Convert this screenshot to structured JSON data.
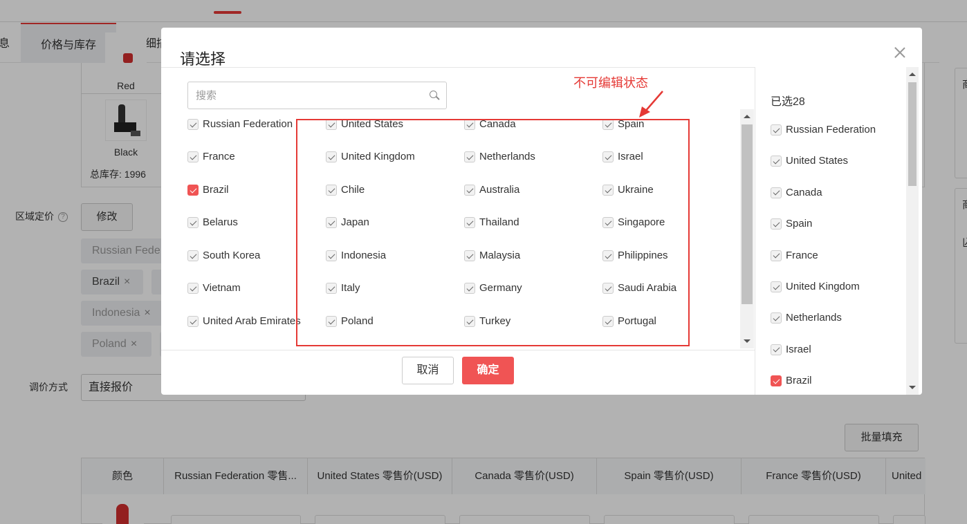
{
  "background": {
    "tabs": [
      {
        "label": "息"
      },
      {
        "label": "价格与库存"
      },
      {
        "label": "详细描"
      }
    ],
    "products": [
      {
        "name": "Red"
      },
      {
        "name": "Black"
      }
    ],
    "total_stock_label": "总库存:",
    "total_stock_value": "1996",
    "regional_pricing_label": "区域定价",
    "help_icon": "?",
    "modify_button": "修改",
    "chips": [
      {
        "text": "Russian Fede"
      },
      {
        "text": "Brazil"
      },
      {
        "text": "Indonesia"
      },
      {
        "text": "Poland"
      }
    ],
    "chip_close_glyph": "×",
    "pricing_method_label": "调价方式",
    "pricing_method_value": "直接报价",
    "batch_fill_button": "批量填充",
    "table_headers": [
      "颜色",
      "Russian Federation 零售...",
      "United States 零售价(USD)",
      "Canada 零售价(USD)",
      "Spain 零售价(USD)",
      "France 零售价(USD)",
      "United"
    ],
    "right_panel_glyphs": [
      "商",
      "商",
      "兦"
    ]
  },
  "modal": {
    "title": "请选择",
    "close_icon": "close-icon",
    "search_placeholder": "搜索",
    "search_icon": "search-icon",
    "columns": [
      [
        {
          "label": "Russian Federation",
          "checked": true,
          "editable": false
        },
        {
          "label": "France",
          "checked": true,
          "editable": false
        },
        {
          "label": "Brazil",
          "checked": true,
          "editable": true
        },
        {
          "label": "Belarus",
          "checked": true,
          "editable": false
        },
        {
          "label": "South Korea",
          "checked": true,
          "editable": false
        },
        {
          "label": "Vietnam",
          "checked": true,
          "editable": false
        },
        {
          "label": "United Arab Emirates",
          "checked": true,
          "editable": false
        }
      ],
      [
        {
          "label": "United States",
          "checked": true,
          "editable": false
        },
        {
          "label": "United Kingdom",
          "checked": true,
          "editable": false
        },
        {
          "label": "Chile",
          "checked": true,
          "editable": false
        },
        {
          "label": "Japan",
          "checked": true,
          "editable": false
        },
        {
          "label": "Indonesia",
          "checked": true,
          "editable": false
        },
        {
          "label": "Italy",
          "checked": true,
          "editable": false
        },
        {
          "label": "Poland",
          "checked": true,
          "editable": false
        }
      ],
      [
        {
          "label": "Canada",
          "checked": true,
          "editable": false
        },
        {
          "label": "Netherlands",
          "checked": true,
          "editable": false
        },
        {
          "label": "Australia",
          "checked": true,
          "editable": false
        },
        {
          "label": "Thailand",
          "checked": true,
          "editable": false
        },
        {
          "label": "Malaysia",
          "checked": true,
          "editable": false
        },
        {
          "label": "Germany",
          "checked": true,
          "editable": false
        },
        {
          "label": "Turkey",
          "checked": true,
          "editable": false
        }
      ],
      [
        {
          "label": "Spain",
          "checked": true,
          "editable": false
        },
        {
          "label": "Israel",
          "checked": true,
          "editable": false
        },
        {
          "label": "Ukraine",
          "checked": true,
          "editable": false
        },
        {
          "label": "Singapore",
          "checked": true,
          "editable": false
        },
        {
          "label": "Philippines",
          "checked": true,
          "editable": false
        },
        {
          "label": "Saudi Arabia",
          "checked": true,
          "editable": false
        },
        {
          "label": "Portugal",
          "checked": true,
          "editable": false
        }
      ]
    ],
    "cancel_button": "取消",
    "confirm_button": "确定",
    "selected_count_label": "已选28",
    "selected_items": [
      {
        "label": "Russian Federation",
        "editable": false
      },
      {
        "label": "United States",
        "editable": false
      },
      {
        "label": "Canada",
        "editable": false
      },
      {
        "label": "Spain",
        "editable": false
      },
      {
        "label": "France",
        "editable": false
      },
      {
        "label": "United Kingdom",
        "editable": false
      },
      {
        "label": "Netherlands",
        "editable": false
      },
      {
        "label": "Israel",
        "editable": false
      },
      {
        "label": "Brazil",
        "editable": true
      }
    ]
  },
  "annotation": {
    "text": "不可编辑状态",
    "color": "#e53935"
  },
  "colors": {
    "accent_red": "#f05454",
    "overlay": "rgba(0,0,0,0.3)"
  }
}
